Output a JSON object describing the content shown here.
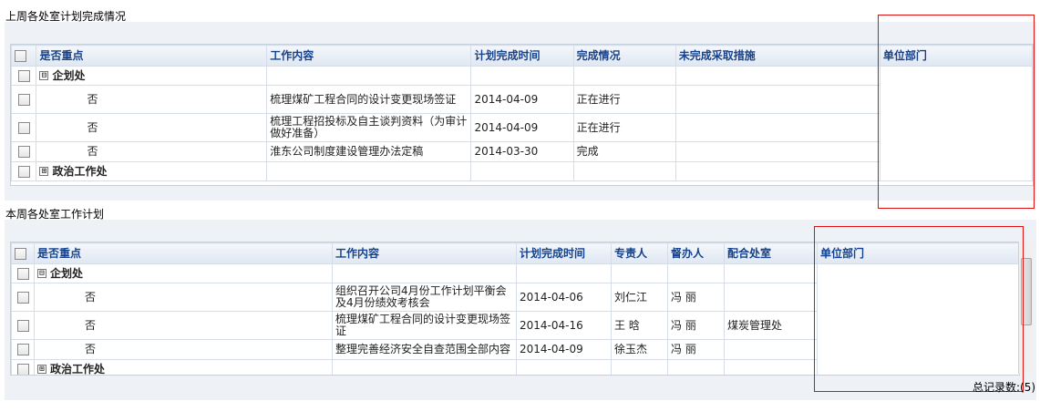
{
  "last_week": {
    "title": "上周各处室计划完成情况",
    "headers": [
      "是否重点",
      "工作内容",
      "计划完成时间",
      "完成情况",
      "未完成采取措施",
      "单位部门"
    ],
    "group1": "企划处",
    "rows": [
      {
        "key": "否",
        "content": "梳理煤矿工程合同的设计变更现场签证",
        "date": "2014-04-09",
        "status": "正在进行",
        "measure": "",
        "dept": ""
      },
      {
        "key": "否",
        "content": "梳理工程招投标及自主谈判资料（为审计做好准备）",
        "date": "2014-04-09",
        "status": "正在进行",
        "measure": "",
        "dept": ""
      },
      {
        "key": "否",
        "content": "淮东公司制度建设管理办法定稿",
        "date": "2014-03-30",
        "status": "完成",
        "measure": "",
        "dept": ""
      }
    ],
    "group2": "政治工作处",
    "collapse_symbol": "⊟",
    "expand_symbol": "⊞"
  },
  "this_week": {
    "title": "本周各处室工作计划",
    "headers": [
      "是否重点",
      "工作内容",
      "计划完成时间",
      "专责人",
      "督办人",
      "配合处室",
      "单位部门"
    ],
    "group1": "企划处",
    "rows": [
      {
        "key": "否",
        "content": "组织召开公司4月份工作计划平衡会及4月份绩效考核会",
        "date": "2014-04-06",
        "owner": "刘仁江",
        "supervisor": "冯 丽",
        "coop": "",
        "dept": ""
      },
      {
        "key": "否",
        "content": "梳理煤矿工程合同的设计变更现场签证",
        "date": "2014-04-16",
        "owner": "王 晗",
        "supervisor": "冯 丽",
        "coop": "煤炭管理处",
        "dept": ""
      },
      {
        "key": "否",
        "content": "整理完善经济安全自查范围全部内容",
        "date": "2014-04-09",
        "owner": "徐玉杰",
        "supervisor": "冯 丽",
        "coop": "",
        "dept": ""
      }
    ],
    "group2": "政治工作处",
    "total_label": "总记录数:(5)"
  },
  "colors": {
    "header_text": "#15428b",
    "red_box": "#e01010",
    "panel_bg": "#eef2f7"
  }
}
